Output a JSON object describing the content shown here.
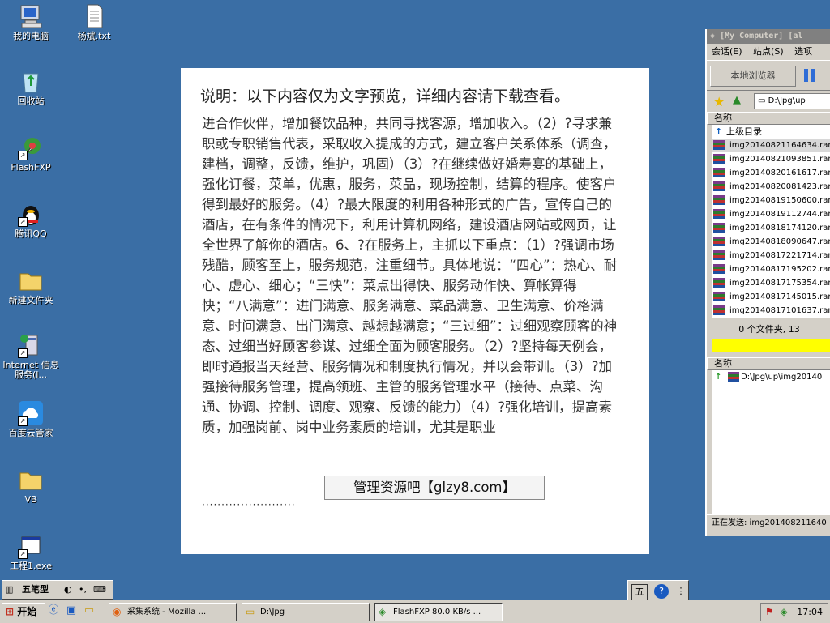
{
  "desktop": {
    "icons": [
      {
        "label": "我的电脑",
        "icon": "my-computer-icon"
      },
      {
        "label": "杨斌.txt",
        "icon": "text-file-icon"
      },
      {
        "label": "回收站",
        "icon": "recycle-bin-icon"
      },
      {
        "label": "FlashFXP",
        "icon": "flashfxp-icon"
      },
      {
        "label": "腾讯QQ",
        "icon": "qq-penguin-icon"
      },
      {
        "label": "新建文件夹",
        "icon": "folder-icon"
      },
      {
        "label": "Internet 信息服务(I...",
        "icon": "iis-icon"
      },
      {
        "label": "百度云管家",
        "icon": "baidu-cloud-icon"
      },
      {
        "label": "VB",
        "icon": "folder-icon"
      },
      {
        "label": "工程1.exe",
        "icon": "exe-icon"
      }
    ]
  },
  "document": {
    "title": "说明：以下内容仅为文字预览，详细内容请下载查看。",
    "body": "进合作伙伴，增加餐饮品种，共同寻找客源，增加收入。（2）?寻求兼职或专职销售代表，采取收入提成的方式，建立客户关系体系（调查，建档，调整，反馈，维护，巩固）（3）?在继续做好婚寿宴的基础上，强化订餐，菜单，优惠，服务，菜品，现场控制，结算的程序。使客户得到最好的服务。（4）?最大限度的利用各种形式的广告，宣传自己的酒店，在有条件的情况下，利用计算机网络，建设酒店网站或网页，让全世界了解你的酒店。6、?在服务上，主抓以下重点：（1）?强调市场残酷，顾客至上，服务规范，注重细节。具体地说：“四心”：热心、耐心、虚心、细心；“三快”：菜点出得快、服务动作快、算帐算得快；“八满意”：进门满意、服务满意、菜品满意、卫生满意、价格满意、时间满意、出门满意、越想越满意；“三过细”：过细观察顾客的神态、过细当好顾客参谋、过细全面为顾客服务。（2）?坚持每天例会，即时通报当天经营、服务情况和制度执行情况，并以会带训。（3）?加强接待服务管理，提高领班、主管的服务管理水平（接待、点菜、沟通、协调、控制、调度、观察、反馈的能力）（4）?强化培训，提高素质，加强岗前、岗中业务素质的培训，尤其是职业",
    "banner": "管理资源吧【glzy8.com】",
    "dots": "························"
  },
  "ftp": {
    "title": "[My Computer] [al",
    "menu": [
      "会话(E)",
      "站点(S)",
      "选项"
    ],
    "browse_button": "本地浏览器",
    "path": "D:\\Jpg\\up",
    "col_name": "名称",
    "up_dir": "上级目录",
    "files": [
      "img20140821164634.rar",
      "img20140821093851.rar",
      "img20140820161617.rar",
      "img20140820081423.rar",
      "img20140819150600.rar",
      "img20140819112744.rar",
      "img20140818174120.rar",
      "img20140818090647.rar",
      "img20140817221714.rar",
      "img20140817195202.rar",
      "img20140817175354.rar",
      "img20140817145015.rar",
      "img20140817101637.rar"
    ],
    "count": "0 个文件夹, 13",
    "queue_col": "名称",
    "queue_item": "D:\\Jpg\\up\\img20140",
    "status": "正在发送: img201408211640"
  },
  "ime": {
    "mode": "五笔型"
  },
  "taskbar": {
    "start": "开始",
    "buttons": [
      {
        "label": "采集系统 - Mozilla ...",
        "icon": "firefox-icon"
      },
      {
        "label": "D:\\Jpg",
        "icon": "folder-icon"
      },
      {
        "label": "FlashFXP 80.0 KB/s ...",
        "icon": "flashfxp-icon"
      }
    ],
    "clock": "17:04"
  }
}
